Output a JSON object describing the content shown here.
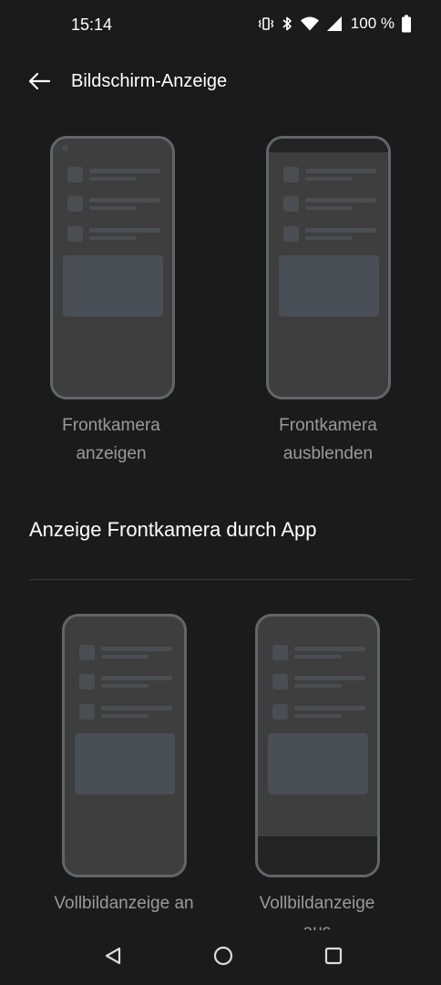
{
  "status_bar": {
    "time": "15:14",
    "battery_percent": "100 %",
    "icons": [
      "vibrate-icon",
      "bluetooth-icon",
      "wifi-icon",
      "cell-signal-icon",
      "battery-icon"
    ]
  },
  "app_bar": {
    "title": "Bildschirm-Anzeige",
    "back_icon": "arrow-left-icon"
  },
  "options_top": [
    {
      "label_line1": "Frontkamera",
      "label_line2": "anzeigen",
      "variant": "camera-shown"
    },
    {
      "label_line1": "Frontkamera",
      "label_line2": "ausblenden",
      "variant": "camera-hidden"
    }
  ],
  "section": {
    "title": "Anzeige Frontkamera durch App"
  },
  "options_bottom": [
    {
      "label_line1": "Vollbildanzeige an",
      "label_line2": "",
      "variant": "fullscreen-on"
    },
    {
      "label_line1": "Vollbildanzeige",
      "label_line2": "aus",
      "variant": "fullscreen-off"
    }
  ],
  "nav_bar": {
    "icons": [
      "back-triangle-icon",
      "home-circle-icon",
      "recents-square-icon"
    ]
  },
  "colors": {
    "background": "#1b1b1b",
    "phone_frame": "#626569",
    "phone_fill": "#3e3e3e",
    "label_text": "#9a9a9a"
  }
}
